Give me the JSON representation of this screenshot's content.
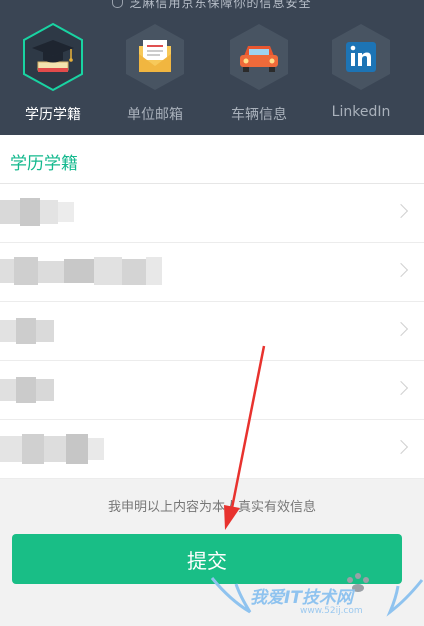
{
  "header": {
    "top_note": "芝麻信用京东保障你的信息安全",
    "categories": [
      {
        "label": "学历学籍",
        "icon": "graduation-cap-icon",
        "active": true
      },
      {
        "label": "单位邮箱",
        "icon": "envelope-icon",
        "active": false
      },
      {
        "label": "车辆信息",
        "icon": "car-icon",
        "active": false
      },
      {
        "label": "LinkedIn",
        "icon": "linkedin-icon",
        "active": false
      }
    ]
  },
  "section": {
    "title": "学历学籍"
  },
  "rows": [
    {
      "label": "",
      "blurred": true
    },
    {
      "label": "",
      "blurred": true
    },
    {
      "label": "",
      "blurred": true
    },
    {
      "label": "",
      "blurred": true
    },
    {
      "label": "",
      "blurred": true
    }
  ],
  "declaration": "我申明以上内容为本人真实有效信息",
  "submit_label": "提交",
  "watermark": {
    "text": "我爱IT技术网",
    "url": "www.52ij.com"
  },
  "colors": {
    "header_bg": "#3a4554",
    "accent": "#14b98e",
    "button": "#19be86",
    "annotation_arrow": "#e8322e"
  }
}
